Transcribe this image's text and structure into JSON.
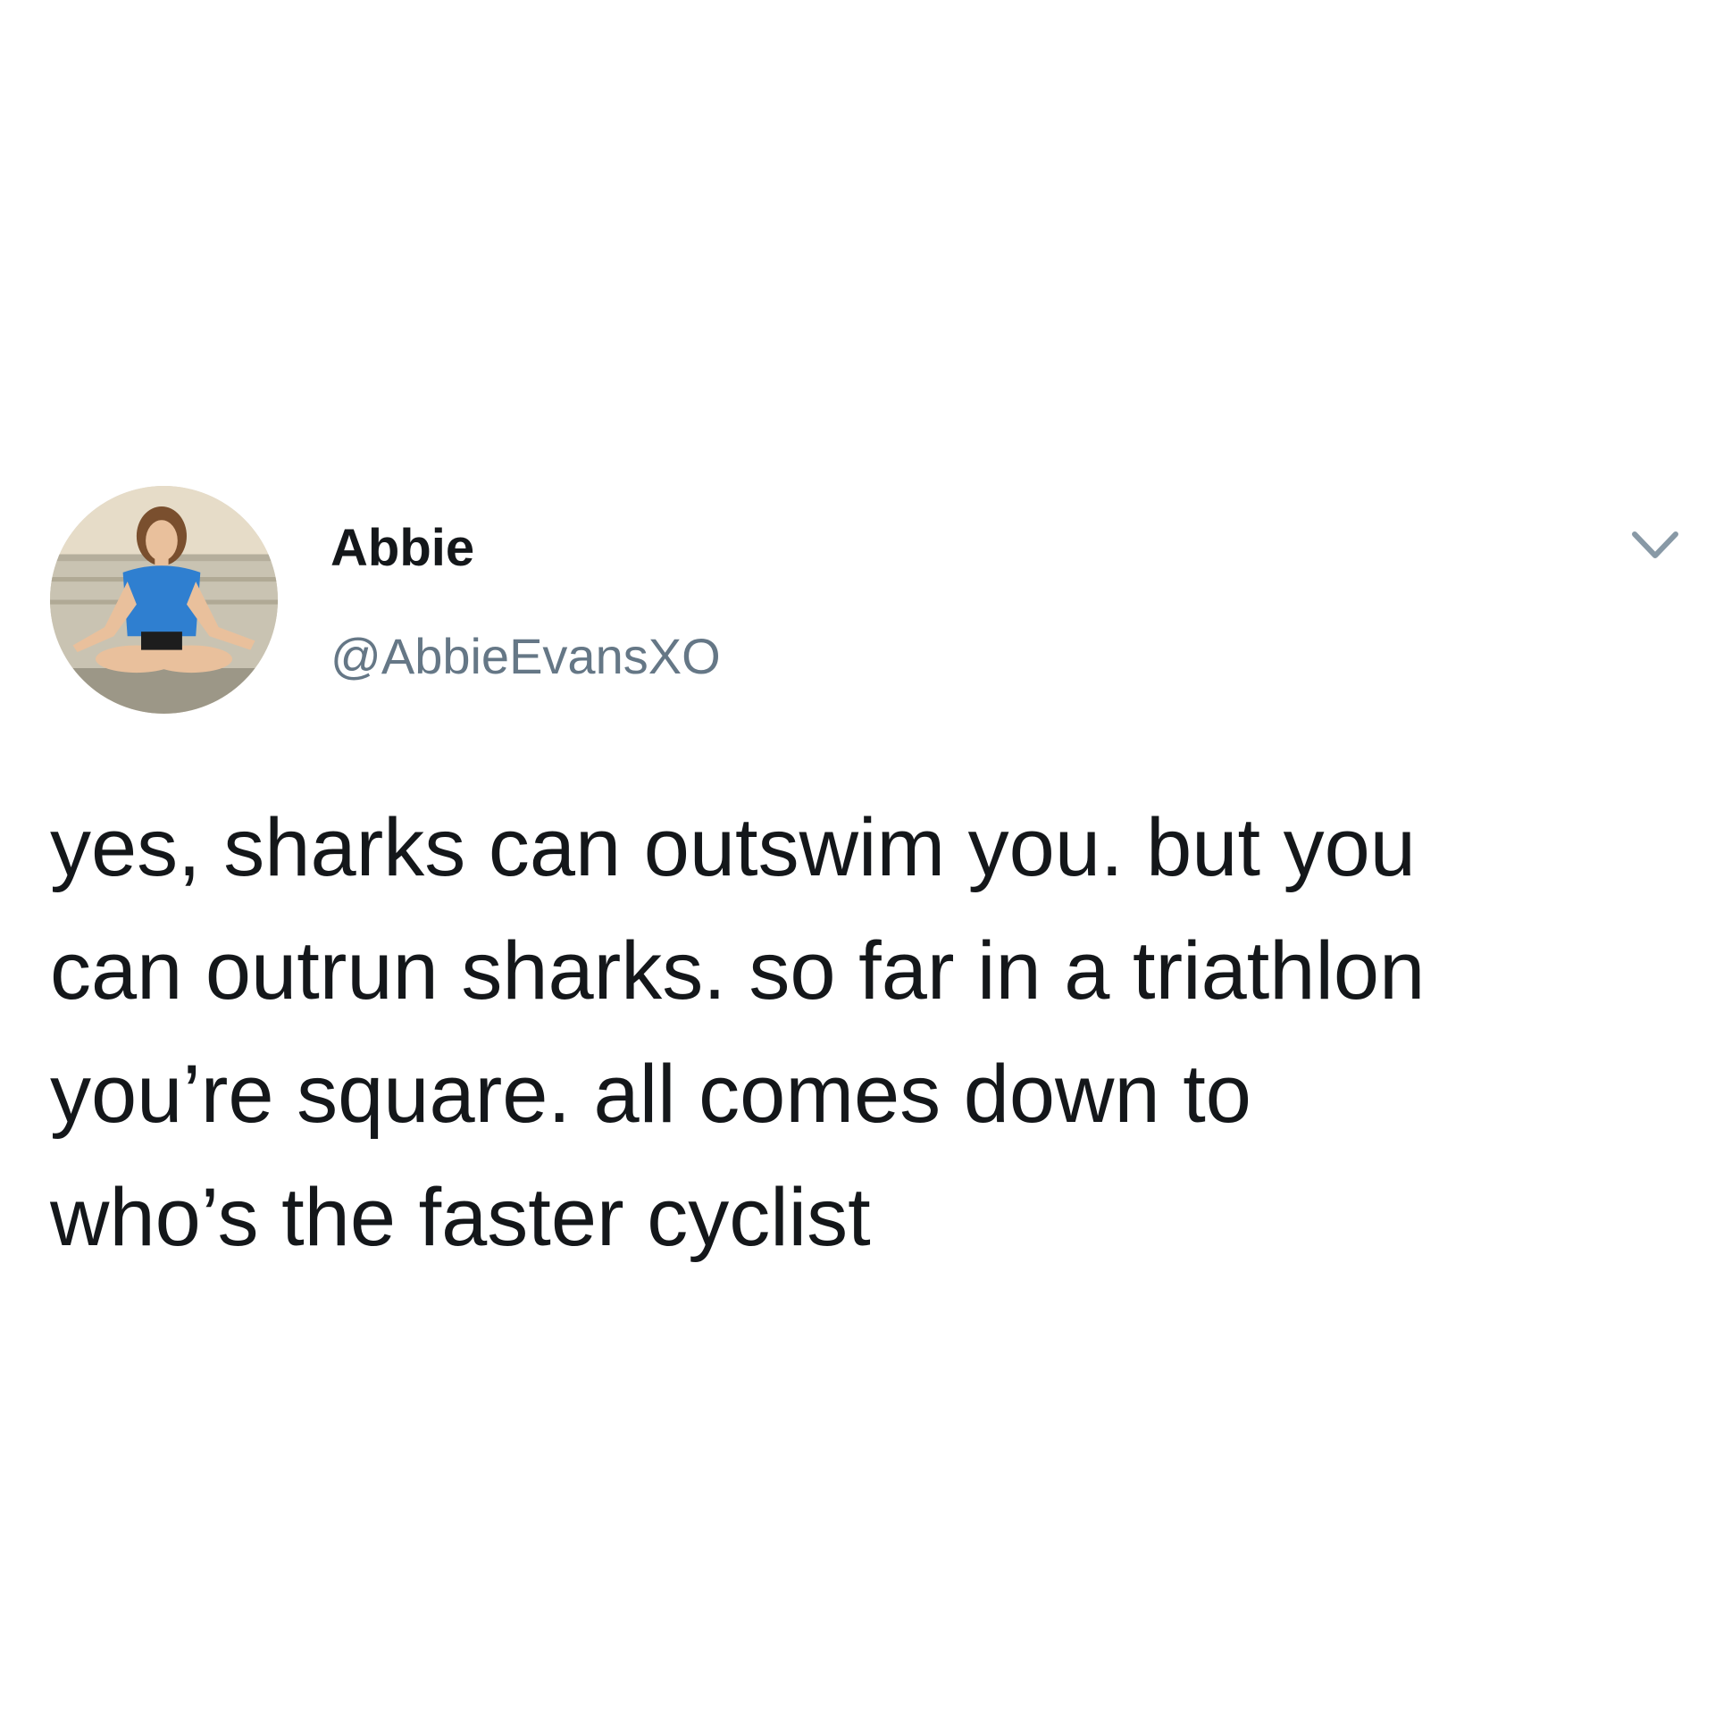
{
  "tweet": {
    "author": {
      "display_name": "Abbie",
      "handle": "@AbbieEvansXO",
      "avatar": "profile-photo"
    },
    "menu_icon": "chevron-down-icon",
    "text_lines": [
      "yes, sharks can outswim you. but you",
      "can outrun sharks. so far in a triathlon",
      "you’re square. all comes down to",
      "who’s the faster cyclist"
    ]
  },
  "colors": {
    "background": "#ffffff",
    "text_primary": "#14171a",
    "text_secondary": "#657786",
    "chevron": "#8899a6"
  }
}
